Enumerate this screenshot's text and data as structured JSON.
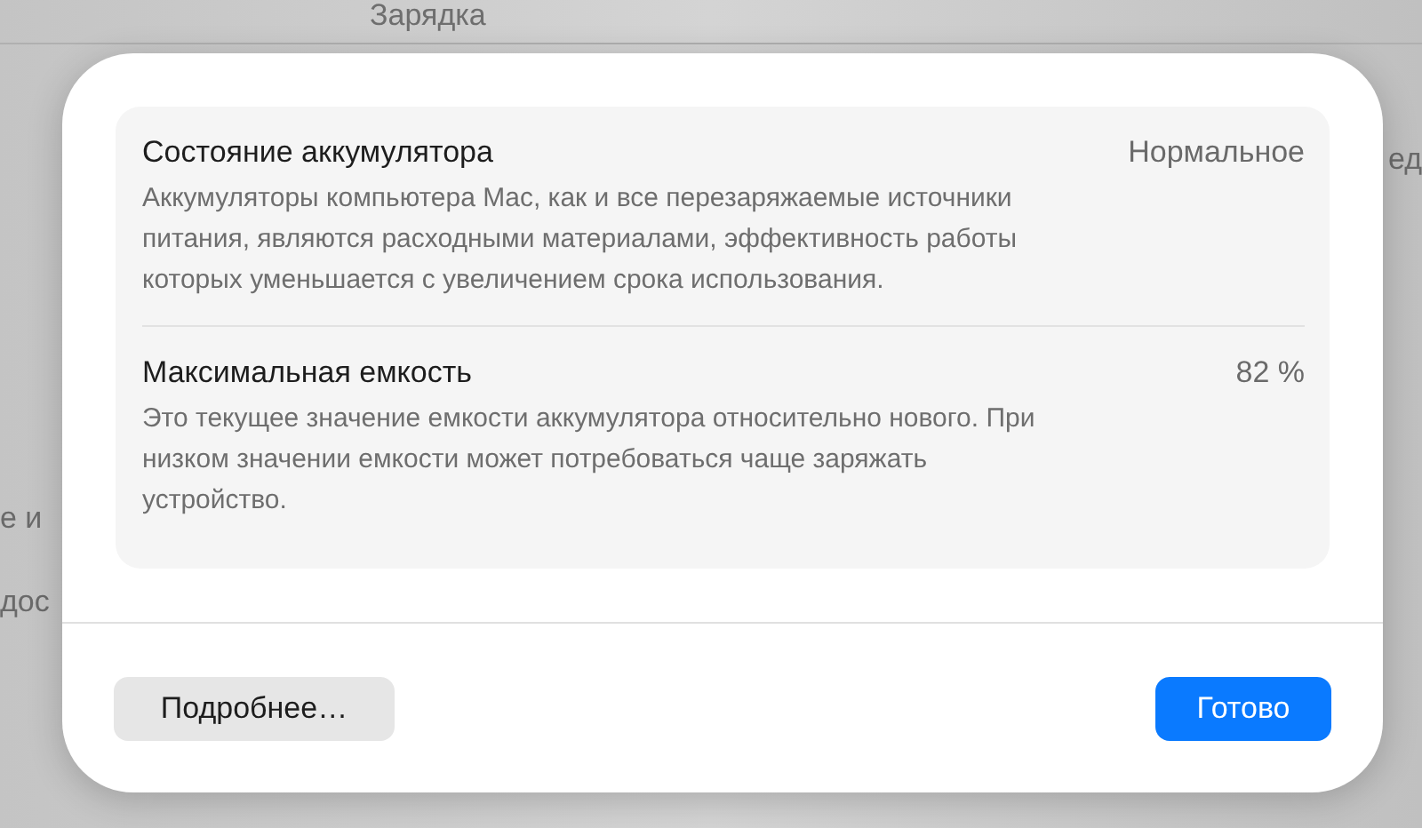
{
  "background": {
    "title": "Зарядка",
    "right_fragment": "ед",
    "left_fragments": [
      "е и",
      "дос"
    ]
  },
  "dialog": {
    "sections": [
      {
        "title": "Состояние аккумулятора",
        "value": "Нормальное",
        "description": "Аккумуляторы компьютера Mac, как и все перезаряжаемые источники питания, являются расходными материалами, эффективность работы которых уменьшается с увеличением срока использования."
      },
      {
        "title": "Максимальная емкость",
        "value": "82 %",
        "description": "Это текущее значение емкости аккумулятора относительно нового. При низком значении емкости может потребоваться чаще заряжать устройство."
      }
    ],
    "buttons": [
      {
        "label": "Подробнее…",
        "kind": "secondary"
      },
      {
        "label": "Готово",
        "kind": "primary"
      }
    ]
  }
}
